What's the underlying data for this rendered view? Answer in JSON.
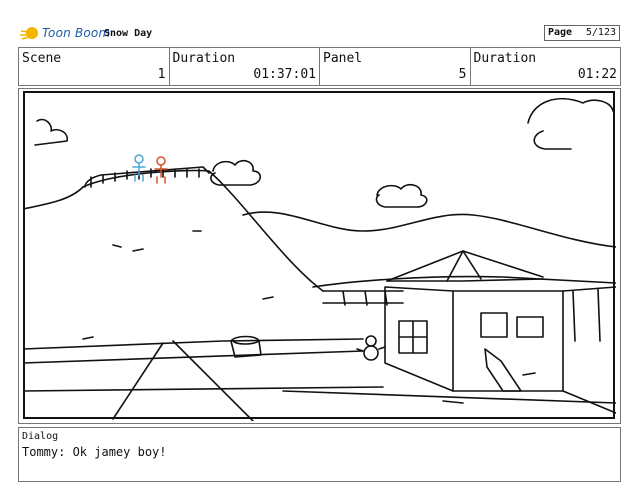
{
  "app": {
    "brand": "Toon Boom",
    "project_title": "Snow Day"
  },
  "page": {
    "label": "Page",
    "value": "5/123"
  },
  "header": {
    "scene_label": "Scene",
    "scene_value": "1",
    "duration_label": "Duration",
    "duration_value": "01:37:01",
    "panel_label": "Panel",
    "panel_value": "5",
    "panel_duration_label": "Duration",
    "panel_duration_value": "01:22"
  },
  "dialog": {
    "label": "Dialog",
    "text": "Tommy: Ok jamey boy!"
  },
  "colors": {
    "brand_text": "#1f5aa6",
    "logo": "#f5b400",
    "character_blue": "#4aa8d8",
    "character_red": "#d9532b",
    "sketch": "#111111"
  },
  "icons": {
    "logo": "toon-boom-logo-icon"
  }
}
